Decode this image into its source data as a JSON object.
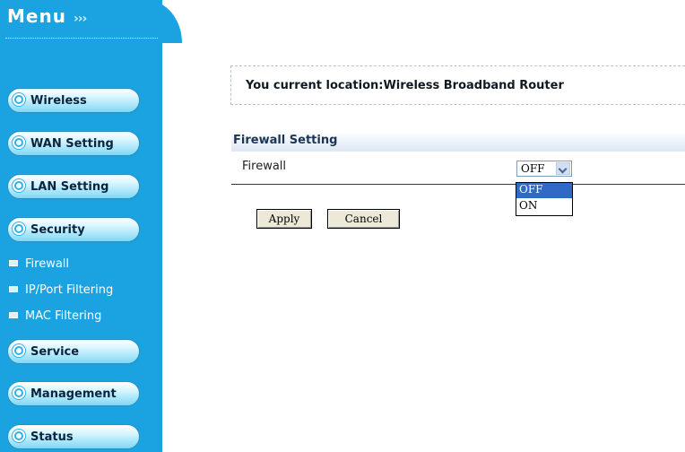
{
  "menu": {
    "title": "Menu",
    "arrows": "›››"
  },
  "nav": {
    "wireless": "Wireless",
    "wan": "WAN Setting",
    "lan": "LAN Setting",
    "security": "Security",
    "service": "Service",
    "management": "Management",
    "status": "Status"
  },
  "security_sub": {
    "firewall": "Firewall",
    "ip_port": "IP/Port Filtering",
    "mac": "MAC Filtering"
  },
  "location": {
    "text": "You current location:Wireless Broadband Router"
  },
  "section": {
    "title": "Firewall Setting"
  },
  "firewall": {
    "label": "Firewall",
    "selected": "OFF",
    "options": [
      "OFF",
      "ON"
    ]
  },
  "buttons": {
    "apply": "Apply",
    "cancel": "Cancel"
  },
  "colors": {
    "sidebar": "#1aa3e0",
    "selected_option": "#3169c6",
    "row_border": "#1e3f70"
  }
}
